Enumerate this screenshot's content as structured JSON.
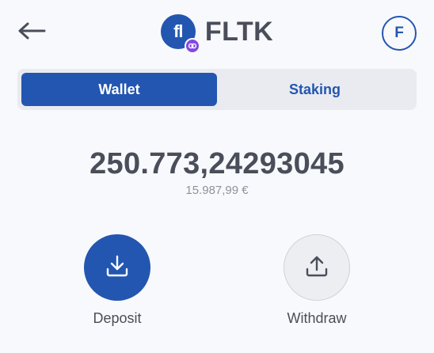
{
  "header": {
    "back_icon": "arrow-left-icon",
    "token_logo_text": "fl",
    "token_name": "FLTK",
    "chain_badge_icon": "polygon-icon",
    "avatar_initial": "F"
  },
  "tabs": [
    {
      "label": "Wallet",
      "active": true
    },
    {
      "label": "Staking",
      "active": false
    }
  ],
  "balance": {
    "amount": "250.773,24293045",
    "fiat": "15.987,99 €"
  },
  "actions": {
    "deposit": {
      "label": "Deposit",
      "icon": "download-icon"
    },
    "withdraw": {
      "label": "Withdraw",
      "icon": "upload-icon"
    }
  },
  "colors": {
    "primary": "#2356b0",
    "chain_badge": "#8247e5",
    "text": "#4a4e5a",
    "muted": "#8e929c",
    "background": "#f8f9fc"
  }
}
